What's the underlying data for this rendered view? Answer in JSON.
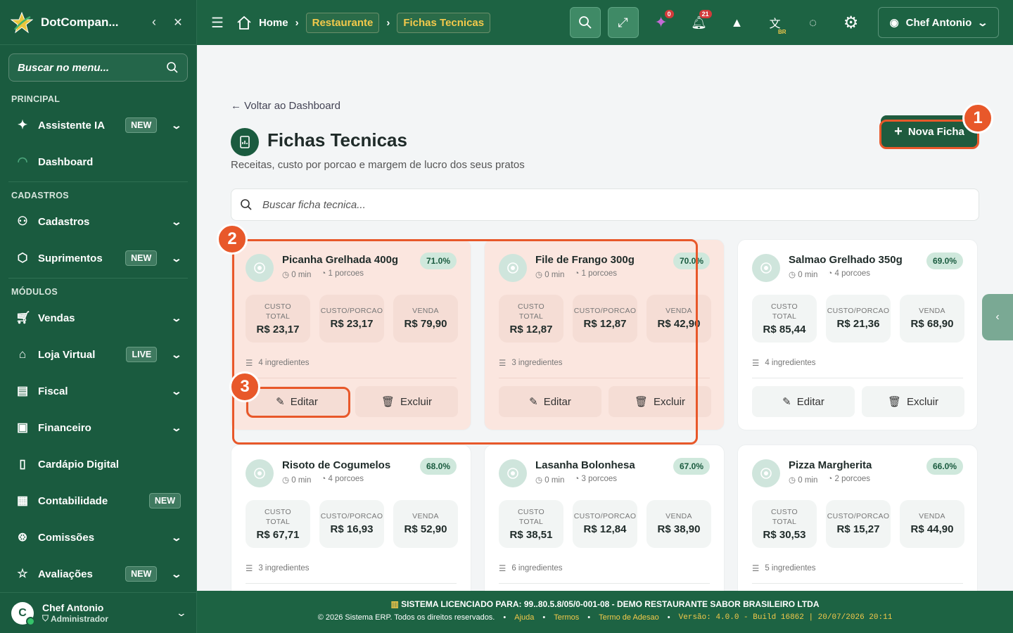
{
  "sidebar": {
    "brand": "DotCompan...",
    "search_placeholder": "Buscar no menu...",
    "sections": {
      "principal": "PRINCIPAL",
      "cadastros": "CADASTROS",
      "modulos": "MÓDULOS"
    },
    "items": [
      {
        "label": "Assistente IA",
        "badge": "NEW",
        "icon": "sparkle-icon"
      },
      {
        "label": "Dashboard",
        "icon": "gauge-icon"
      },
      {
        "label": "Cadastros",
        "icon": "users-icon"
      },
      {
        "label": "Suprimentos",
        "badge": "NEW",
        "icon": "box-icon"
      },
      {
        "label": "Vendas",
        "icon": "cart-icon"
      },
      {
        "label": "Loja Virtual",
        "badge": "LIVE",
        "icon": "store-icon"
      },
      {
        "label": "Fiscal",
        "icon": "receipt-icon"
      },
      {
        "label": "Financeiro",
        "icon": "money-icon"
      },
      {
        "label": "Cardápio Digital",
        "icon": "phone-icon"
      },
      {
        "label": "Contabilidade",
        "badge": "NEW",
        "icon": "calculator-icon"
      },
      {
        "label": "Comissões",
        "icon": "commission-icon"
      },
      {
        "label": "Avaliações",
        "badge": "NEW",
        "icon": "star-icon"
      }
    ],
    "user": {
      "initial": "C",
      "name": "Chef Antonio",
      "role": "Administrador"
    }
  },
  "topbar": {
    "breadcrumb": [
      "Home",
      "Restaurante",
      "Fichas Tecnicas"
    ],
    "notif_ai": "0",
    "notif_bell": "21",
    "lang_tag": "BR",
    "user": "Chef Antonio"
  },
  "page": {
    "back": "Voltar ao Dashboard",
    "title": "Fichas Tecnicas",
    "subtitle": "Receitas, custo por porcao e margem de lucro dos seus pratos",
    "new_button": "Nova Ficha",
    "search_placeholder": "Buscar ficha tecnica..."
  },
  "labels": {
    "custo_total_1": "CUSTO",
    "custo_total_2": "TOTAL",
    "custo_porcao": "CUSTO/PORCAO",
    "venda": "VENDA",
    "edit": "Editar",
    "delete": "Excluir"
  },
  "cards": [
    {
      "name": "Picanha Grelhada 400g",
      "pct": "71.0%",
      "time": "0 min",
      "portions": "1 porcoes",
      "total": "R$ 23,17",
      "porcao": "R$ 23,17",
      "venda": "R$ 79,90",
      "ingredients": "4 ingredientes"
    },
    {
      "name": "File de Frango 300g",
      "pct": "70.0%",
      "time": "0 min",
      "portions": "1 porcoes",
      "total": "R$ 12,87",
      "porcao": "R$ 12,87",
      "venda": "R$ 42,90",
      "ingredients": "3 ingredientes"
    },
    {
      "name": "Salmao Grelhado 350g",
      "pct": "69.0%",
      "time": "0 min",
      "portions": "4 porcoes",
      "total": "R$ 85,44",
      "porcao": "R$ 21,36",
      "venda": "R$ 68,90",
      "ingredients": "4 ingredientes"
    },
    {
      "name": "Risoto de Cogumelos",
      "pct": "68.0%",
      "time": "0 min",
      "portions": "4 porcoes",
      "total": "R$ 67,71",
      "porcao": "R$ 16,93",
      "venda": "R$ 52,90",
      "ingredients": "3 ingredientes"
    },
    {
      "name": "Lasanha Bolonhesa",
      "pct": "67.0%",
      "time": "0 min",
      "portions": "3 porcoes",
      "total": "R$ 38,51",
      "porcao": "R$ 12,84",
      "venda": "R$ 38,90",
      "ingredients": "6 ingredientes"
    },
    {
      "name": "Pizza Margherita",
      "pct": "66.0%",
      "time": "0 min",
      "portions": "2 porcoes",
      "total": "R$ 30,53",
      "porcao": "R$ 15,27",
      "venda": "R$ 44,90",
      "ingredients": "5 ingredientes"
    }
  ],
  "annotations": [
    "1",
    "2",
    "3"
  ],
  "footer": {
    "license_prefix": "SISTEMA LICENCIADO PARA:",
    "license_value": "99..80.5.8/05/0-001-08 - DEMO RESTAURANTE SABOR BRASILEIRO LTDA",
    "copyright": "© 2026 Sistema ERP. Todos os direitos reservados.",
    "links": [
      "Ajuda",
      "Termos",
      "Termo de Adesao"
    ],
    "version": "Versão: 4.0.0 - Build 16862 | 20/07/2026 20:11"
  },
  "colors": {
    "primary": "#1a5b3f",
    "accent": "#f3c94b",
    "highlight": "#e8582a"
  }
}
